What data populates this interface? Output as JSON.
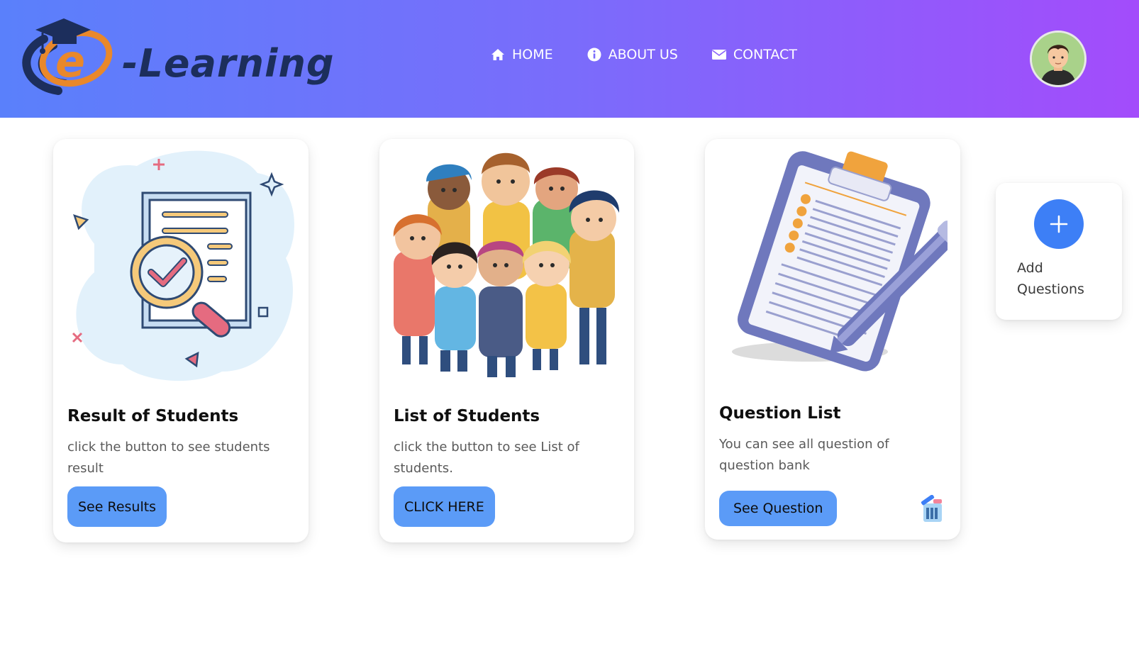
{
  "header": {
    "logo_text": "-Learning",
    "logo_letter": "e",
    "nav": [
      {
        "label": "HOME",
        "icon": "home-icon"
      },
      {
        "label": "ABOUT US",
        "icon": "info-icon"
      },
      {
        "label": "CONTACT",
        "icon": "envelope-icon"
      }
    ],
    "avatar_icon": "user-avatar-icon"
  },
  "cards": [
    {
      "title": "Result of Students",
      "description": "click the button to see students result",
      "button": "See Results",
      "illustration": "document-magnifier-check-icon"
    },
    {
      "title": "List of Students",
      "description": "click the button to see List of students.",
      "button": "CLICK HERE",
      "illustration": "group-of-students-image"
    },
    {
      "title": "Question List",
      "description": "You can see all question of question bank",
      "button": "See Question",
      "illustration": "clipboard-pen-icon",
      "extra_icon": "trash-icon"
    }
  ],
  "add_card": {
    "label": "Add Questions",
    "icon": "plus-icon"
  },
  "colors": {
    "header_gradient_start": "#5a80fb",
    "header_gradient_end": "#a34cfb",
    "button": "#5b9bf7",
    "add_circle": "#3d7ff6"
  }
}
